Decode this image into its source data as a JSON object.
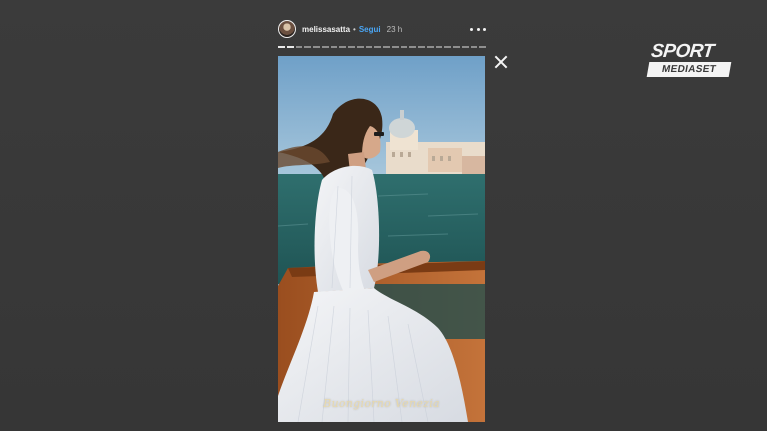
{
  "story": {
    "username": "melissasatta",
    "separator": "•",
    "follow_label": "Segui",
    "time_ago": "23 h",
    "segments_total": 24,
    "segments_viewed": 2,
    "caption": "Buongiorno Venezia",
    "more_icon": "more-horizontal-icon",
    "close_icon": "close-icon"
  },
  "watermark": {
    "line1": "SPORT",
    "line2": "MEDIASET"
  },
  "colors": {
    "background": "#3a3a3a",
    "follow_blue": "#4aa6f5",
    "text": "#f2f2f2"
  }
}
